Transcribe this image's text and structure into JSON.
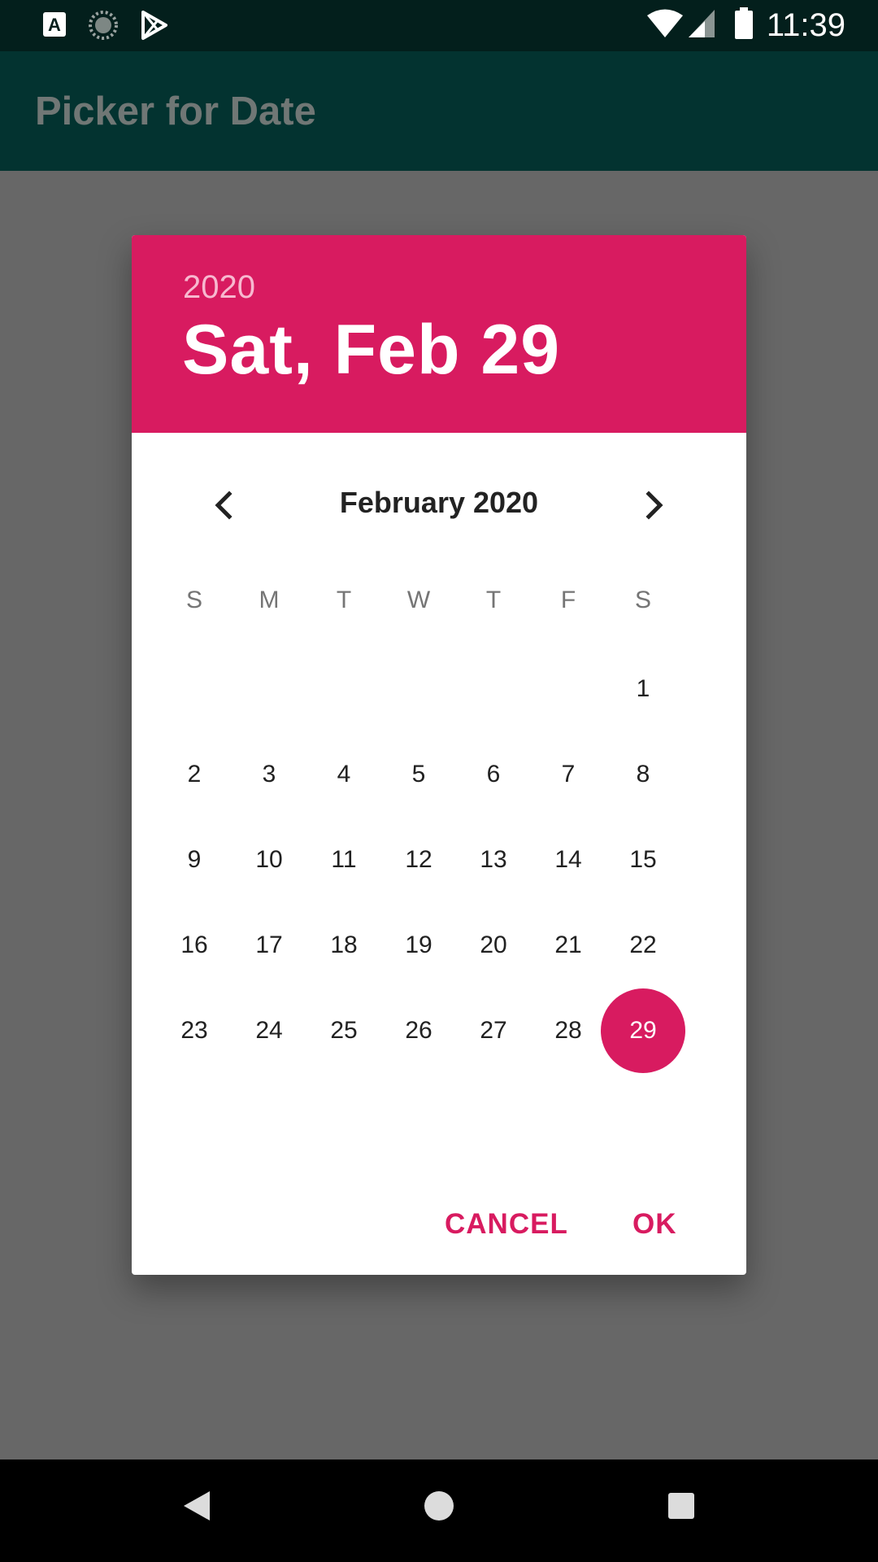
{
  "status_bar": {
    "time": "11:39",
    "left_icons": [
      "a-notification-icon",
      "loading-circle-icon",
      "play-store-icon"
    ],
    "right_icons": [
      "wifi-icon",
      "cellular-signal-icon",
      "battery-icon"
    ]
  },
  "app_bar": {
    "title": "Picker for Date"
  },
  "dialog": {
    "year": "2020",
    "selected_date": "Sat, Feb 29",
    "month_label": "February 2020",
    "weekdays": [
      "S",
      "M",
      "T",
      "W",
      "T",
      "F",
      "S"
    ],
    "weeks": [
      [
        "",
        "",
        "",
        "",
        "",
        "",
        "1"
      ],
      [
        "2",
        "3",
        "4",
        "5",
        "6",
        "7",
        "8"
      ],
      [
        "9",
        "10",
        "11",
        "12",
        "13",
        "14",
        "15"
      ],
      [
        "16",
        "17",
        "18",
        "19",
        "20",
        "21",
        "22"
      ],
      [
        "23",
        "24",
        "25",
        "26",
        "27",
        "28",
        "29"
      ]
    ],
    "selected_day": "29",
    "cancel_label": "CANCEL",
    "ok_label": "OK",
    "accent_color": "#d81b60"
  }
}
